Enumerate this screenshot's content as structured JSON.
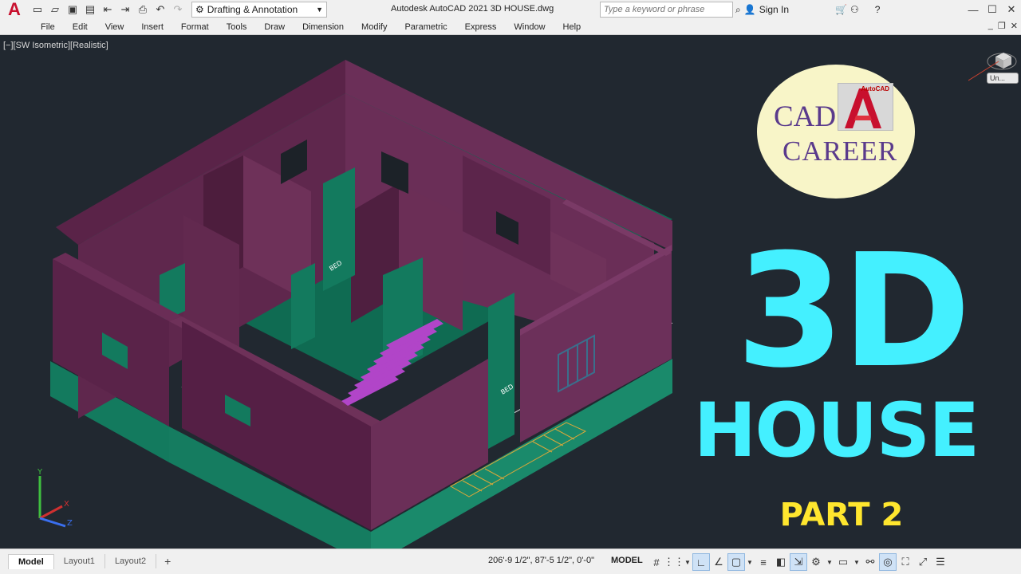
{
  "titlebar": {
    "app_logo": "A",
    "quick_access": [
      "new-icon",
      "open-icon",
      "save-icon",
      "save-as-icon",
      "import-icon",
      "export-icon",
      "print-icon",
      "undo-icon",
      "redo-icon"
    ],
    "workspace": "Drafting & Annotation",
    "title": "Autodesk AutoCAD 2021    3D HOUSE.dwg",
    "search_placeholder": "Type a keyword or phrase",
    "sign_in": "Sign In"
  },
  "menubar": {
    "items": [
      "File",
      "Edit",
      "View",
      "Insert",
      "Format",
      "Tools",
      "Draw",
      "Dimension",
      "Modify",
      "Parametric",
      "Express",
      "Window",
      "Help"
    ]
  },
  "viewport": {
    "label": "[−][SW Isometric][Realistic]",
    "ucs_name": "Un...",
    "room_labels": [
      "BED",
      "BED"
    ]
  },
  "overlay": {
    "brand_line1": "CAD",
    "brand_line2": "CAREER",
    "brand_logo_text": "AutoCAD",
    "headline_1": "3D",
    "headline_2": "HOUSE",
    "headline_3": "PART 2",
    "accent_color": "#44f0ff",
    "part_color": "#ffe62e"
  },
  "axes": {
    "y": "Y",
    "x": "X",
    "z": "Z"
  },
  "statusbar": {
    "tabs": [
      "Model",
      "Layout1",
      "Layout2"
    ],
    "add_tab": "+",
    "coordinates": "206'-9 1/2\", 87'-5 1/2\", 0'-0\"",
    "mode": "MODEL"
  }
}
